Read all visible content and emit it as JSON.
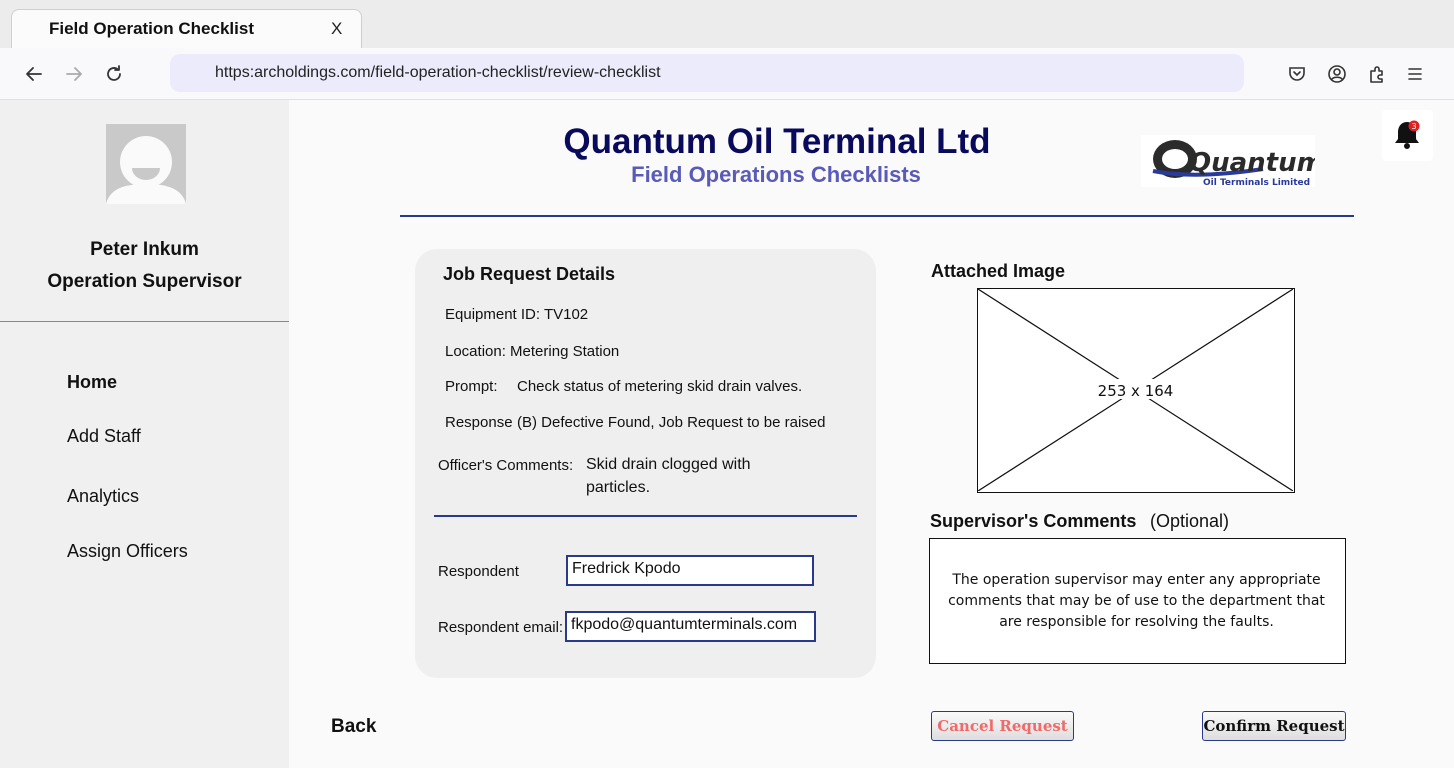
{
  "browser": {
    "tab_title": "Field Operation Checklist",
    "tab_close": "X",
    "url": "https:archoldings.com/field-operation-checklist/review-checklist"
  },
  "sidebar": {
    "user_name": "Peter Inkum",
    "user_role": "Operation Supervisor",
    "items": [
      {
        "label": "Home"
      },
      {
        "label": "Add Staff"
      },
      {
        "label": "Analytics"
      },
      {
        "label": "Assign Officers"
      }
    ]
  },
  "header": {
    "title": "Quantum Oil Terminal Ltd",
    "subtitle": "Field Operations Checklists",
    "logo_word": "Quantum",
    "logo_caption": "Oil Terminals Limited",
    "notification_count": "3"
  },
  "job_request": {
    "heading": "Job Request Details",
    "equipment": "Equipment ID: TV102",
    "location": "Location: Metering Station",
    "prompt_label": "Prompt:",
    "prompt_value": "Check status of metering skid drain valves.",
    "response_label": "Response",
    "response_value": "(B) Defective Found, Job Request to be raised",
    "officer_comments_label": "Officer's Comments:",
    "officer_comments_line1": "Skid drain clogged with",
    "officer_comments_line2": "particles.",
    "respondent_label": "Respondent",
    "respondent_value": "Fredrick Kpodo",
    "email_label": "Respondent email:",
    "email_value": "fkpodo@quantumterminals.com"
  },
  "attachment": {
    "heading": "Attached Image",
    "placeholder": "253 x 164"
  },
  "supervisor": {
    "heading": "Supervisor's Comments",
    "optional": "(Optional)",
    "comment": "The operation supervisor may enter any appropriate comments that may be of use to the department that are responsible for resolving the faults."
  },
  "actions": {
    "back": "Back",
    "cancel": "Cancel Request",
    "confirm": "Confirm Request"
  },
  "colors": {
    "title": "#0a0a5c",
    "subtitle": "#5a5ab8",
    "accent_line": "#2a3a8a",
    "cancel_text": "#f06a6a",
    "badge": "#e02020"
  }
}
